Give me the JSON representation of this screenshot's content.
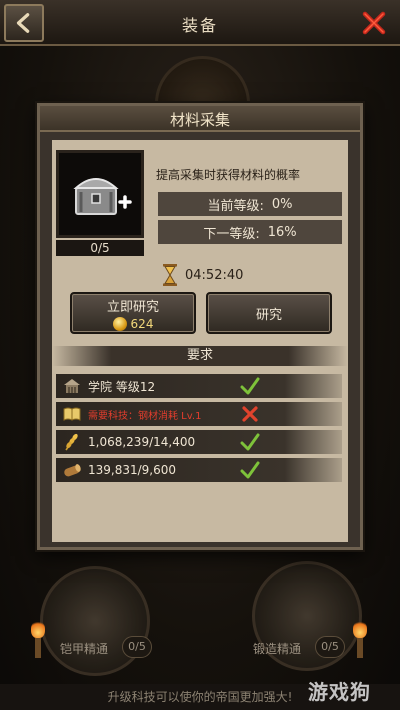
{
  "window": {
    "title": "装备"
  },
  "dialog": {
    "title": "材料采集",
    "item": {
      "icon": "treasure-chest-icon",
      "count": "0/5"
    },
    "description": "提高采集时获得材料的概率",
    "current_level": {
      "label": "当前等级:",
      "value": "0%"
    },
    "next_level": {
      "label": "下一等级:",
      "value": "16%"
    },
    "timer": "04:52:40",
    "instant_button": {
      "label": "立即研究",
      "cost": "624"
    },
    "research_button": {
      "label": "研究"
    },
    "requirements": {
      "header": "要求",
      "items": [
        {
          "icon": "academy-icon",
          "text": "学院 等级12",
          "met": true
        },
        {
          "icon": "scroll-book-icon",
          "text": "需要科技：钢材消耗 Lv.1",
          "met": false
        },
        {
          "icon": "grain-icon",
          "text": "1,068,239/14,400",
          "met": true
        },
        {
          "icon": "wood-log-icon",
          "text": "139,831/9,600",
          "met": true
        }
      ]
    }
  },
  "background": {
    "left_label": "铠甲精通",
    "left_count": "0/5",
    "right_label": "锻造精通",
    "right_count": "0/5",
    "footer_tip": "升级科技可以使你的帝国更加强大!",
    "watermark": "游戏狗"
  },
  "colors": {
    "met": "#7ec23a",
    "unmet": "#e0432d",
    "coin": "#f3d97b"
  }
}
